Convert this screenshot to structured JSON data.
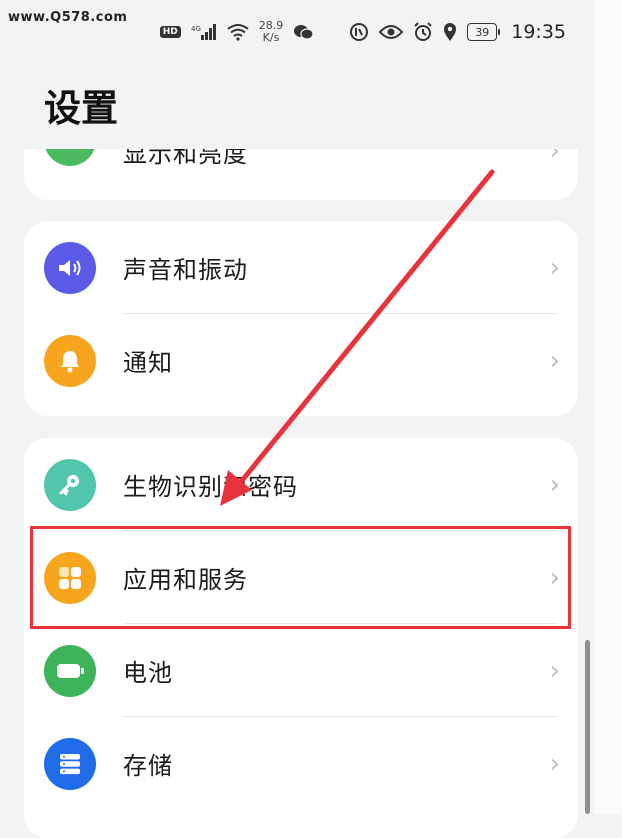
{
  "watermark": "www.Q578.com",
  "status_bar": {
    "hd": "HD",
    "network": "4G",
    "net_speed_value": "28.9",
    "net_speed_unit": "K/s",
    "battery": "39",
    "time": "19:35",
    "icons": [
      "hd-icon",
      "signal-icon",
      "wifi-icon",
      "wechat-icon",
      "do-not-disturb-icon",
      "eye-comfort-icon",
      "alarm-icon",
      "location-icon",
      "battery-icon"
    ]
  },
  "page": {
    "title": "设置"
  },
  "groups": [
    {
      "items": [
        {
          "label": "显示和亮度",
          "icon": "display-icon",
          "color": "#4cba61"
        }
      ]
    },
    {
      "items": [
        {
          "label": "声音和振动",
          "icon": "sound-icon",
          "color": "#5a5ae6"
        },
        {
          "label": "通知",
          "icon": "bell-icon",
          "color": "#f7a51c"
        }
      ]
    },
    {
      "items": [
        {
          "label": "生物识别和密码",
          "icon": "key-icon",
          "color": "#52c6ac"
        },
        {
          "label": "应用和服务",
          "icon": "apps-icon",
          "color": "#f7a51c"
        },
        {
          "label": "电池",
          "icon": "battery-icon",
          "color": "#3db45a"
        },
        {
          "label": "存储",
          "icon": "storage-icon",
          "color": "#1f6be8"
        }
      ]
    }
  ],
  "annotation": {
    "highlight_color": "#e8333b"
  }
}
